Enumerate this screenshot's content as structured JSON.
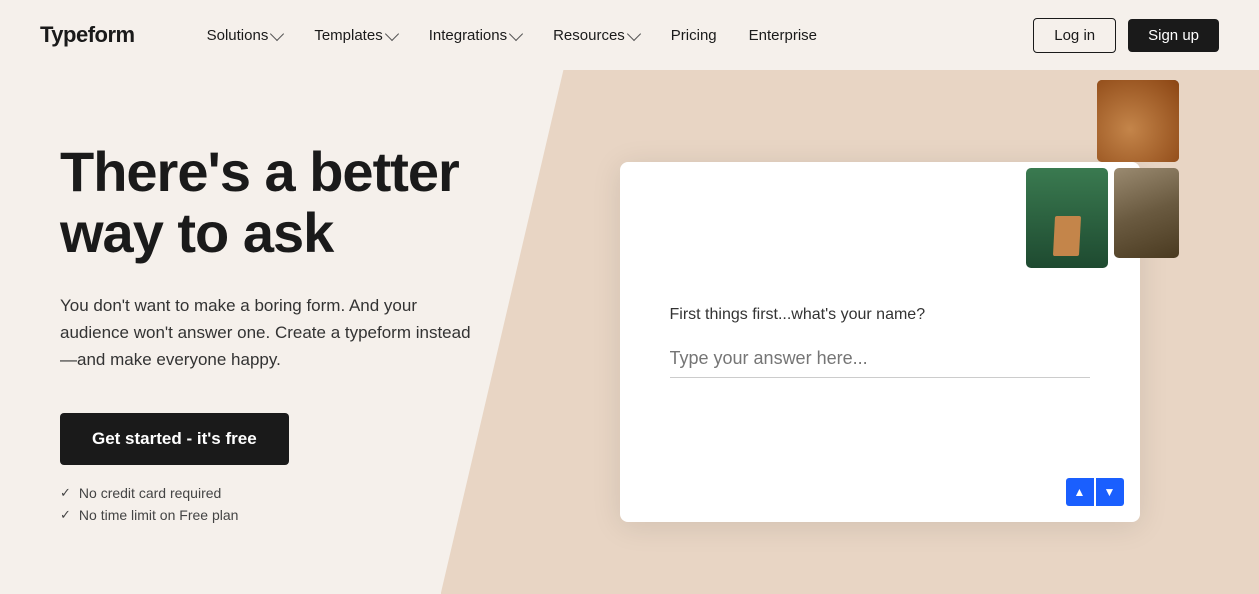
{
  "brand": {
    "name": "Typeform"
  },
  "nav": {
    "items": [
      {
        "label": "Solutions",
        "hasDropdown": true
      },
      {
        "label": "Templates",
        "hasDropdown": true
      },
      {
        "label": "Integrations",
        "hasDropdown": true
      },
      {
        "label": "Resources",
        "hasDropdown": true
      },
      {
        "label": "Pricing",
        "hasDropdown": false
      },
      {
        "label": "Enterprise",
        "hasDropdown": false
      }
    ],
    "login_label": "Log in",
    "signup_label": "Sign up"
  },
  "hero": {
    "title": "There's a better way to ask",
    "subtitle": "You don't want to make a boring form. And your audience won't answer one. Create a typeform instead—and make everyone happy.",
    "cta_label": "Get started - it's free",
    "checks": [
      "No credit card required",
      "No time limit on Free plan"
    ]
  },
  "form_preview": {
    "question": "First things first...what's your name?",
    "placeholder": "Type your answer here...",
    "nav_up": "▲",
    "nav_down": "▼"
  }
}
